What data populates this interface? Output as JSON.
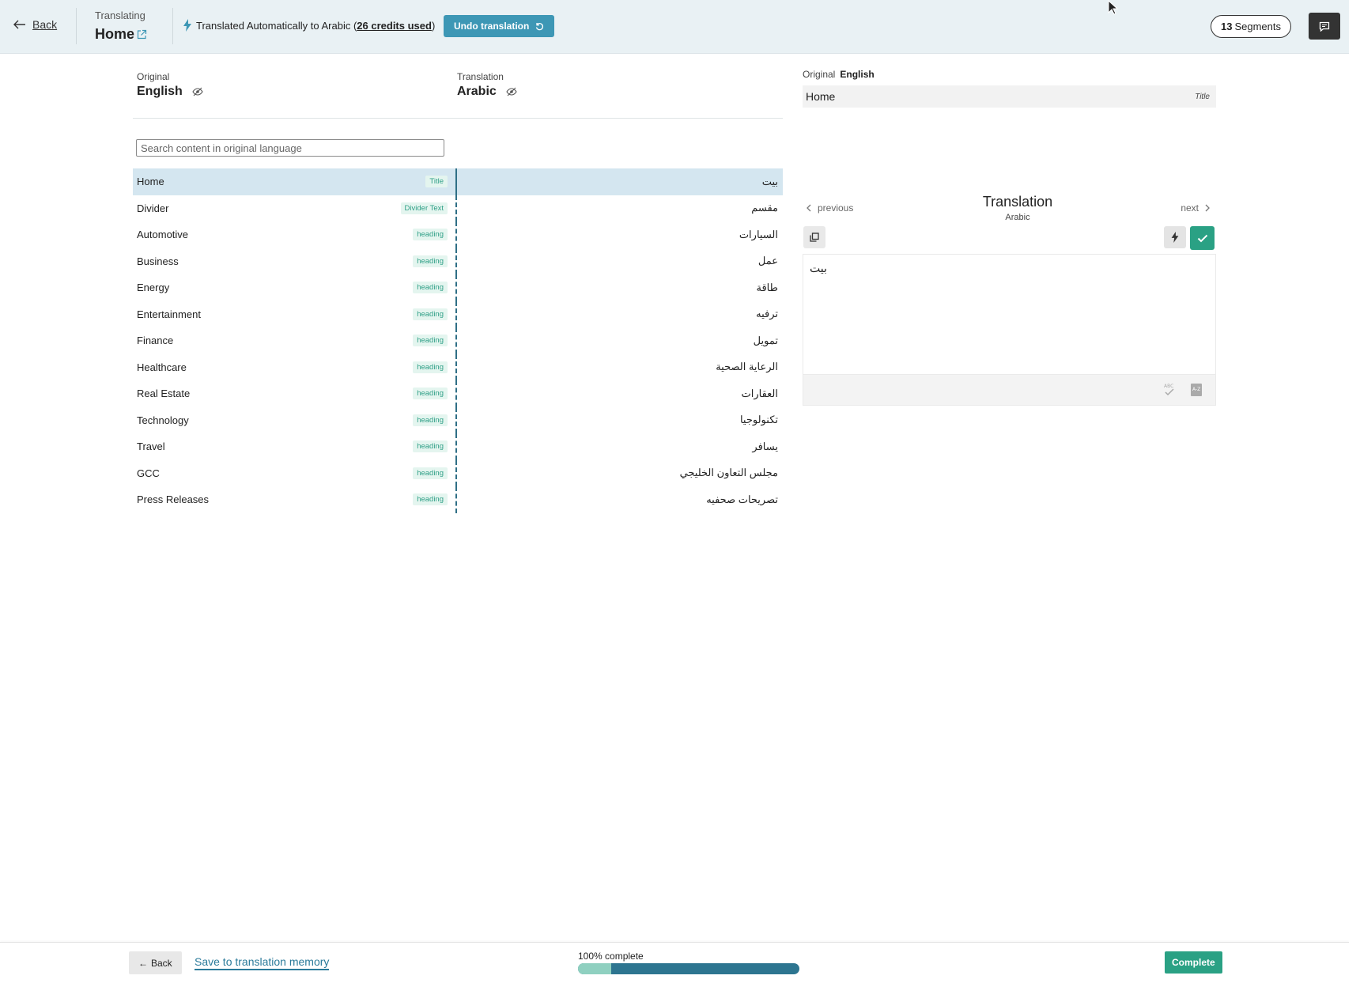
{
  "header": {
    "back_label": "Back",
    "crumb_label": "Translating",
    "page_title": "Home",
    "auto_status_prefix": "Translated Automatically to Arabic (",
    "credits_text": "26 credits used",
    "auto_status_suffix": ")",
    "undo_label": "Undo translation",
    "segments_count": "13",
    "segments_label": "Segments"
  },
  "languages": {
    "original_label": "Original",
    "original_lang": "English",
    "translation_label": "Translation",
    "translation_lang": "Arabic"
  },
  "search": {
    "placeholder": "Search content in original language"
  },
  "segments": [
    {
      "original": "Home",
      "tag": "Title",
      "translation": "بيت"
    },
    {
      "original": "Divider",
      "tag": "Divider Text",
      "translation": "مقسم"
    },
    {
      "original": "Automotive",
      "tag": "heading",
      "translation": "السيارات"
    },
    {
      "original": "Business",
      "tag": "heading",
      "translation": "عمل"
    },
    {
      "original": "Energy",
      "tag": "heading",
      "translation": "طاقة"
    },
    {
      "original": "Entertainment",
      "tag": "heading",
      "translation": "ترفيه"
    },
    {
      "original": "Finance",
      "tag": "heading",
      "translation": "تمويل"
    },
    {
      "original": "Healthcare",
      "tag": "heading",
      "translation": "الرعاية الصحية"
    },
    {
      "original": "Real Estate",
      "tag": "heading",
      "translation": "العقارات"
    },
    {
      "original": "Technology",
      "tag": "heading",
      "translation": "تكنولوجيا"
    },
    {
      "original": "Travel",
      "tag": "heading",
      "translation": "يسافر"
    },
    {
      "original": "GCC",
      "tag": "heading",
      "translation": "مجلس التعاون الخليجي"
    },
    {
      "original": "Press Releases",
      "tag": "heading",
      "translation": "تصريحات صحفيه"
    }
  ],
  "editor": {
    "original_label": "Original",
    "original_lang": "English",
    "original_text": "Home",
    "original_tag": "Title",
    "prev_label": "previous",
    "next_label": "next",
    "title": "Translation",
    "lang": "Arabic",
    "value": "بيت"
  },
  "footer": {
    "back_label": "Back",
    "save_label": "Save to translation memory",
    "progress_label": "100% complete",
    "progress_fill_fraction": 0.15,
    "complete_label": "Complete"
  },
  "colors": {
    "accent_blue": "#3d97b5",
    "accent_green": "#2aa184",
    "progress_dark": "#2d7590",
    "progress_light": "#8fd0c0"
  }
}
